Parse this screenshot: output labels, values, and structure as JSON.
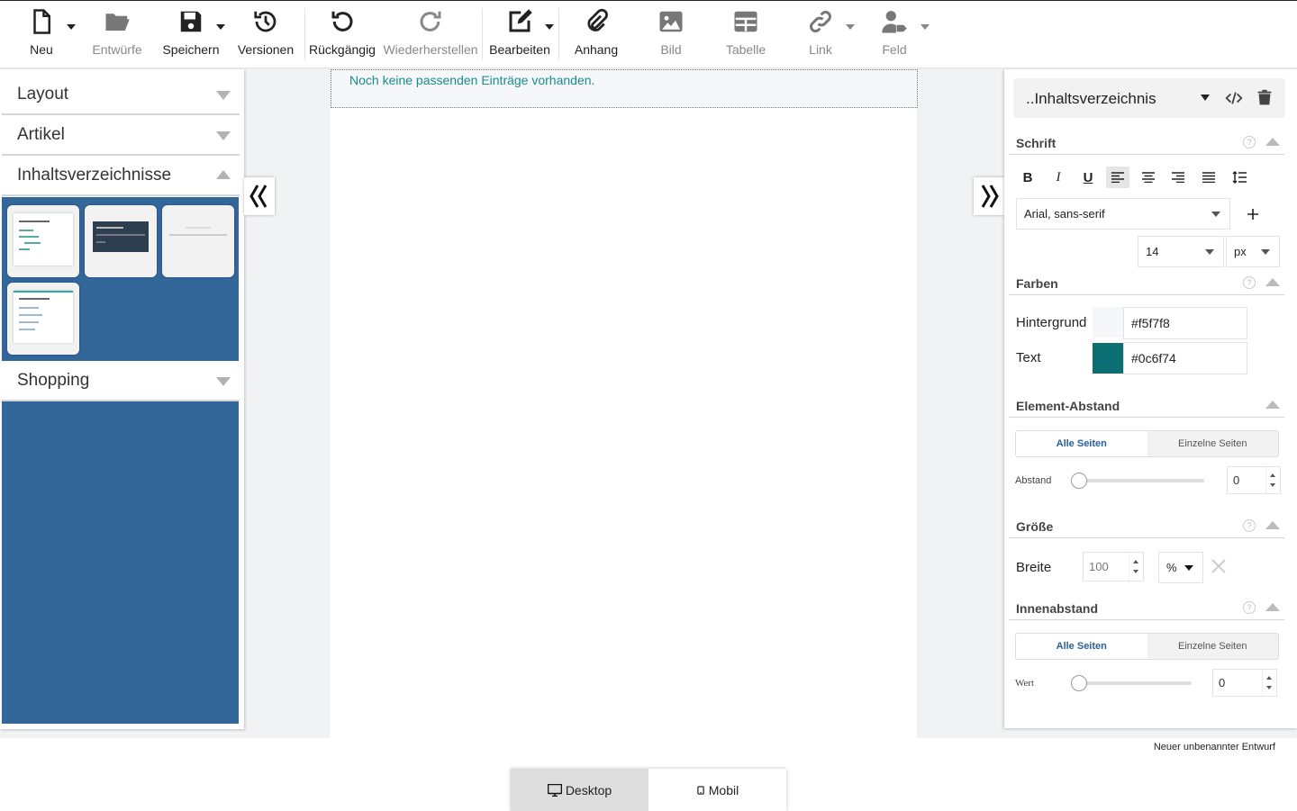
{
  "toolbar": {
    "new": "Neu",
    "drafts": "Entwürfe",
    "save": "Speichern",
    "versions": "Versionen",
    "undo": "Rückgängig",
    "redo": "Wiederherstellen",
    "edit": "Bearbeiten",
    "attachment": "Anhang",
    "image": "Bild",
    "table": "Tabelle",
    "link": "Link",
    "field": "Feld"
  },
  "left_panel": {
    "sections": [
      {
        "label": "Layout"
      },
      {
        "label": "Artikel"
      },
      {
        "label": "Inhaltsverzeichnisse"
      },
      {
        "label": "Shopping"
      }
    ]
  },
  "canvas": {
    "empty_note": "Noch keine passenden Einträge vorhanden."
  },
  "right_panel": {
    "element_title": "..Inhaltsverzeichnis",
    "font": {
      "heading": "Schrift",
      "family": "Arial, sans-serif",
      "size": "14",
      "unit": "px"
    },
    "colors": {
      "heading": "Farben",
      "background_label": "Hintergrund",
      "background_value": "#f5f7f8",
      "text_label": "Text",
      "text_value": "#0c6f74"
    },
    "spacing": {
      "heading": "Element-Abstand",
      "all_sides": "Alle Seiten",
      "single_sides": "Einzelne Seiten",
      "label": "Abstand",
      "value": "0"
    },
    "size": {
      "heading": "Größe",
      "width_label": "Breite",
      "width_value": "100",
      "unit": "%"
    },
    "padding": {
      "heading": "Innenabstand",
      "all_sides": "Alle Seiten",
      "single_sides": "Einzelne Seiten",
      "label": "Wert",
      "value": "0"
    }
  },
  "status": {
    "draft_name": "Neuer unbenannter Entwurf"
  },
  "view": {
    "desktop": "Desktop",
    "mobile": "Mobil"
  },
  "colors": {
    "accent_blue": "#336699",
    "text_teal": "#0c6f74"
  }
}
